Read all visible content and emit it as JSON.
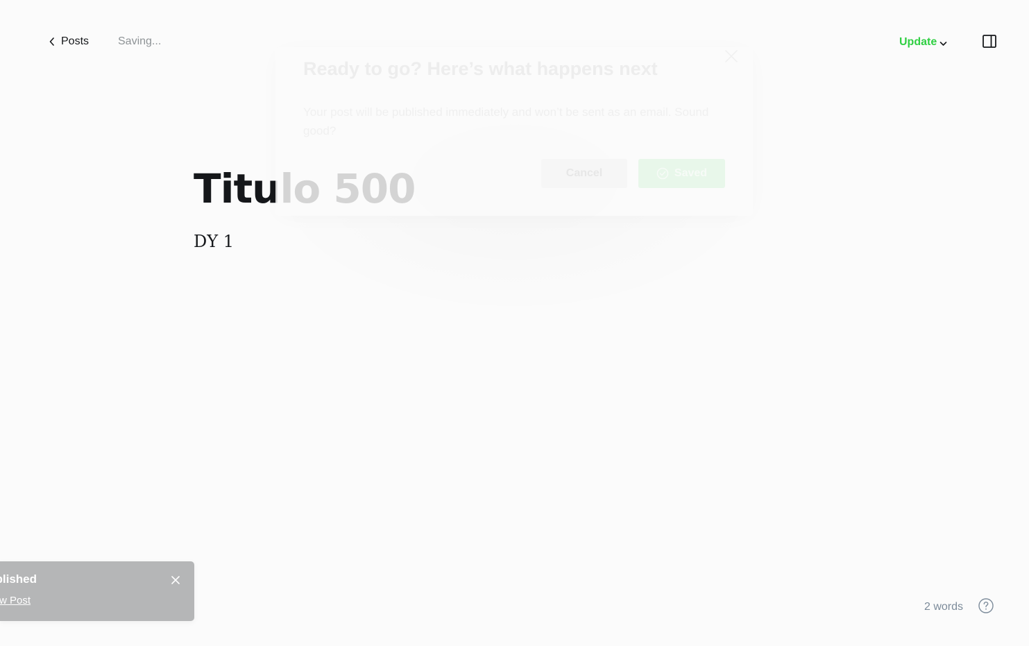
{
  "header": {
    "back_label": "Posts",
    "status": "Saving...",
    "update_label": "Update"
  },
  "editor": {
    "title": "Titulo 500",
    "body": "DY 1"
  },
  "modal": {
    "title": "Ready to go? Here’s what happens next",
    "text": "Your post will be published immediately and won’t be sent as an email. Sound good?",
    "cancel_label": "Cancel",
    "saved_label": "Saved"
  },
  "notification": {
    "title": "blished",
    "link": "w Post"
  },
  "footer": {
    "word_count": "2 words"
  },
  "colors": {
    "accent": "#30cf43",
    "text": "#15171a",
    "muted": "#8e9396",
    "background": "#fbfbfb",
    "notification_bg": "#b5b6b7"
  },
  "icons": {
    "back": "chevron-left-icon",
    "update": "chevron-down-icon",
    "sidebar": "sidebar-panel-icon",
    "close": "close-icon",
    "check": "check-circle-icon",
    "help": "help-circle-icon"
  }
}
